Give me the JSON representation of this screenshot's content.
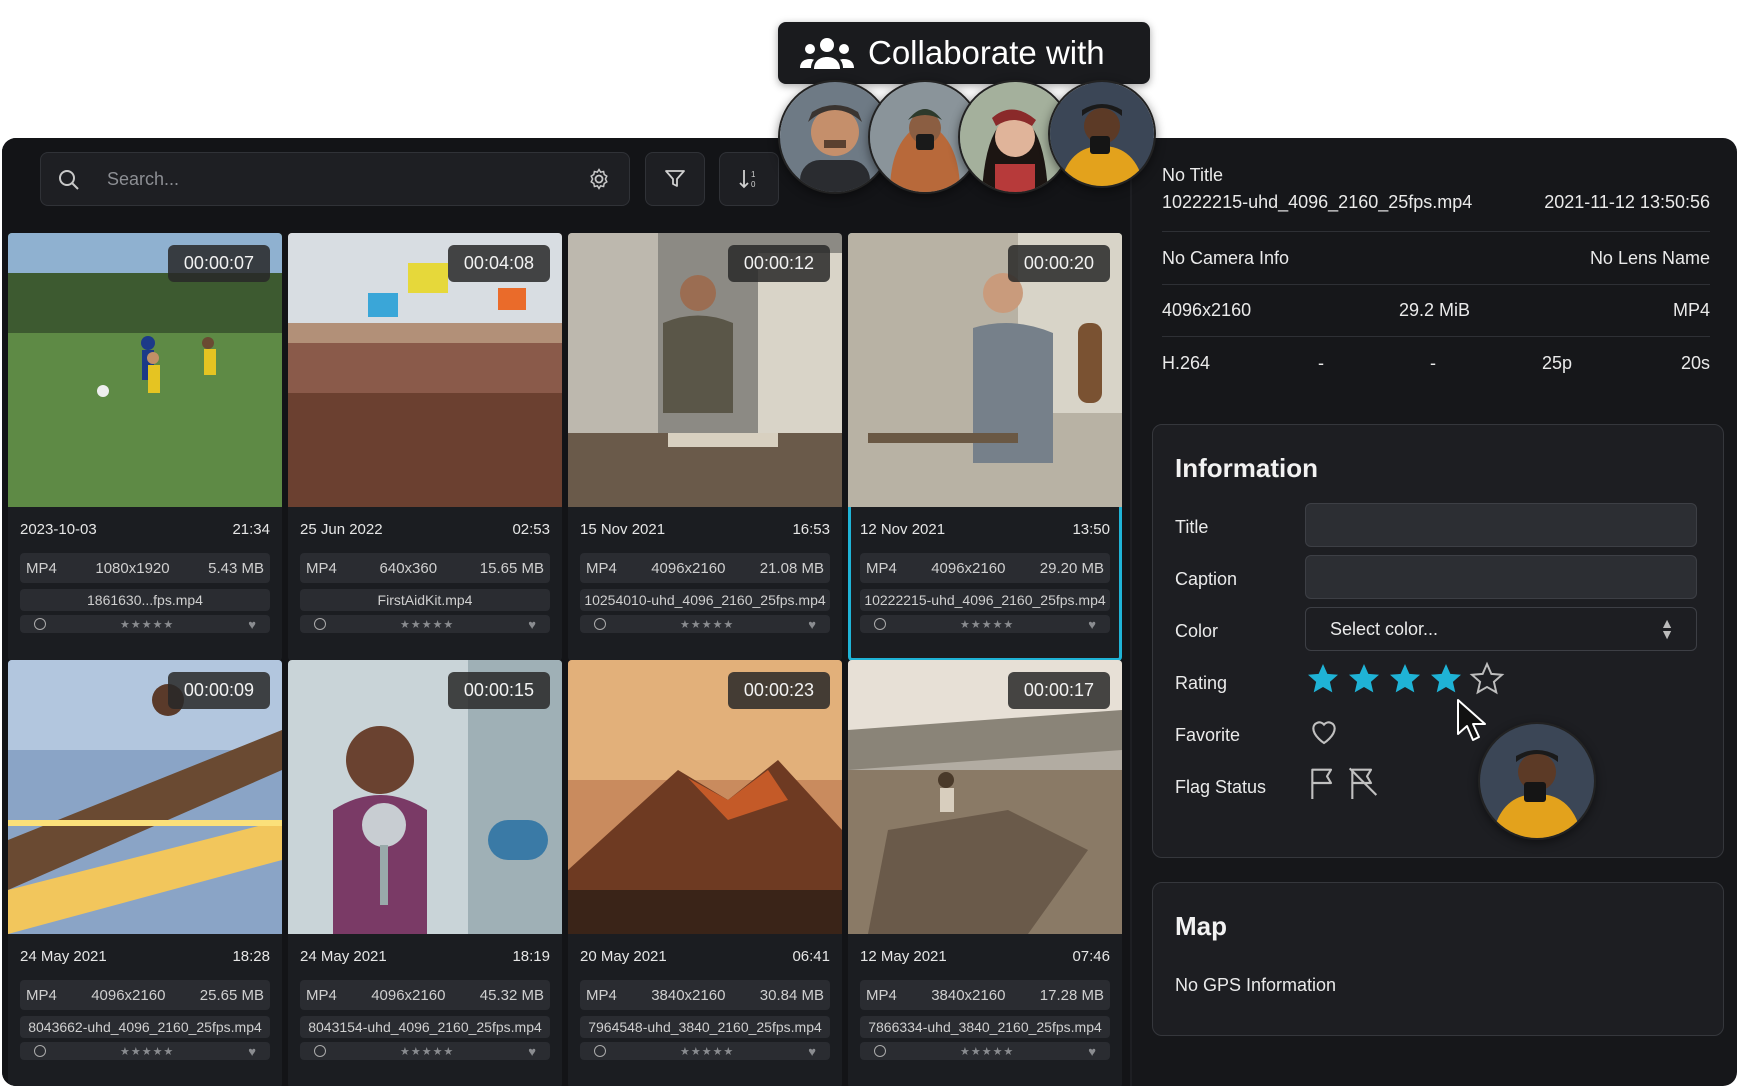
{
  "collab": {
    "label": "Collaborate with"
  },
  "toolbar": {
    "search_placeholder": "Search..."
  },
  "cards": [
    {
      "duration": "00:00:07",
      "date": "2023-10-03",
      "time": "21:34",
      "format": "MP4",
      "resolution": "1080x1920",
      "size": "5.43 MB",
      "filename": "1861630...fps.mp4",
      "selected": false
    },
    {
      "duration": "00:04:08",
      "date": "25 Jun 2022",
      "time": "02:53",
      "format": "MP4",
      "resolution": "640x360",
      "size": "15.65 MB",
      "filename": "FirstAidKit.mp4",
      "selected": false
    },
    {
      "duration": "00:00:12",
      "date": "15 Nov 2021",
      "time": "16:53",
      "format": "MP4",
      "resolution": "4096x2160",
      "size": "21.08 MB",
      "filename": "10254010-uhd_4096_2160_25fps.mp4",
      "selected": false
    },
    {
      "duration": "00:00:20",
      "date": "12 Nov 2021",
      "time": "13:50",
      "format": "MP4",
      "resolution": "4096x2160",
      "size": "29.20 MB",
      "filename": "10222215-uhd_4096_2160_25fps.mp4",
      "selected": true
    },
    {
      "duration": "00:00:09",
      "date": "24 May 2021",
      "time": "18:28",
      "format": "MP4",
      "resolution": "4096x2160",
      "size": "25.65 MB",
      "filename": "8043662-uhd_4096_2160_25fps.mp4",
      "selected": false
    },
    {
      "duration": "00:00:15",
      "date": "24 May 2021",
      "time": "18:19",
      "format": "MP4",
      "resolution": "4096x2160",
      "size": "45.32 MB",
      "filename": "8043154-uhd_4096_2160_25fps.mp4",
      "selected": false
    },
    {
      "duration": "00:00:23",
      "date": "20 May 2021",
      "time": "06:41",
      "format": "MP4",
      "resolution": "3840x2160",
      "size": "30.84 MB",
      "filename": "7964548-uhd_3840_2160_25fps.mp4",
      "selected": false
    },
    {
      "duration": "00:00:17",
      "date": "12 May 2021",
      "time": "07:46",
      "format": "MP4",
      "resolution": "3840x2160",
      "size": "17.28 MB",
      "filename": "7866334-uhd_3840_2160_25fps.mp4",
      "selected": false
    }
  ],
  "details": {
    "title": "No Title",
    "filename": "10222215-uhd_4096_2160_25fps.mp4",
    "datetime": "2021-11-12 13:50:56",
    "camera": "No Camera Info",
    "lens": "No Lens Name",
    "resolution": "4096x2160",
    "size": "29.2 MiB",
    "format": "MP4",
    "codec": "H.264",
    "dash1": "-",
    "dash2": "-",
    "framerate": "25p",
    "duration": "20s"
  },
  "info": {
    "heading": "Information",
    "title_label": "Title",
    "caption_label": "Caption",
    "color_label": "Color",
    "color_value": "Select color...",
    "rating_label": "Rating",
    "rating": 4,
    "rating_max": 5,
    "favorite_label": "Favorite",
    "flag_label": "Flag Status",
    "accent": "#1fb3d6"
  },
  "map": {
    "heading": "Map",
    "text": "No GPS Information"
  }
}
